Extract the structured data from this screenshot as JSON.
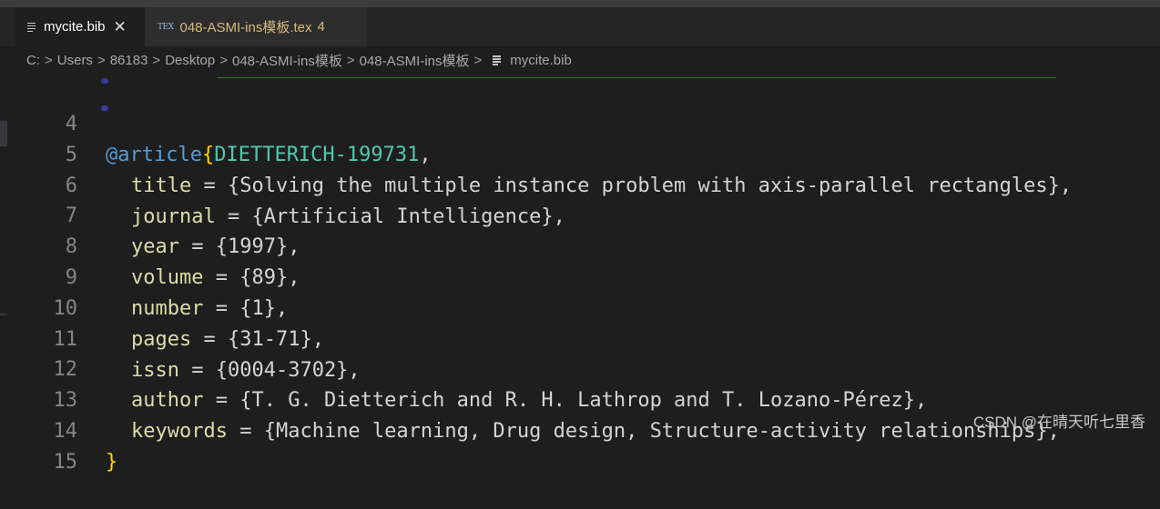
{
  "tabs": [
    {
      "label": "mycite.bib",
      "icon": "file-lines-icon",
      "close": "✕",
      "active": true
    },
    {
      "label": "048-ASMI-ins模板.tex",
      "icon": "tex-icon",
      "icon_text": "TEX",
      "badge": "4",
      "active": false
    }
  ],
  "breadcrumb": [
    "C:",
    "Users",
    "86183",
    "Desktop",
    "048-ASMI-ins模板",
    "048-ASMI-ins模板",
    "mycite.bib"
  ],
  "breadcrumb_sep": ">",
  "code": {
    "entry_type": "@article",
    "open_brace": "{",
    "cite_key": "DIETTERICH-199731",
    "cite_key_comma": ",",
    "fields": [
      {
        "name": "title",
        "value": "{Solving the multiple instance problem with axis-parallel rectangles},"
      },
      {
        "name": "journal",
        "value": "{Artificial Intelligence},"
      },
      {
        "name": "year",
        "value": "{1997},"
      },
      {
        "name": "volume",
        "value": "{89},"
      },
      {
        "name": "number",
        "value": "{1},"
      },
      {
        "name": "pages",
        "value": "{31-71},"
      },
      {
        "name": "issn",
        "value": "{0004-3702},"
      },
      {
        "name": "author",
        "value": "{T. G. Dietterich and R. H. Lathrop and T. Lozano-Pérez},"
      },
      {
        "name": "keywords",
        "value": "{Machine learning, Drug design, Structure-activity relationships},"
      }
    ],
    "equals": " = ",
    "close_brace": "}",
    "line_numbers": [
      "4",
      "5",
      "6",
      "7",
      "8",
      "9",
      "10",
      "11",
      "12",
      "13",
      "14",
      "15"
    ]
  },
  "watermark": "CSDN @在晴天听七里香",
  "colors": {
    "keyword": "#569cd6",
    "brace": "#ffd700",
    "citekey": "#4ec9b0",
    "field": "#dcdcaa",
    "modified_tab": "#d7ba7d"
  }
}
